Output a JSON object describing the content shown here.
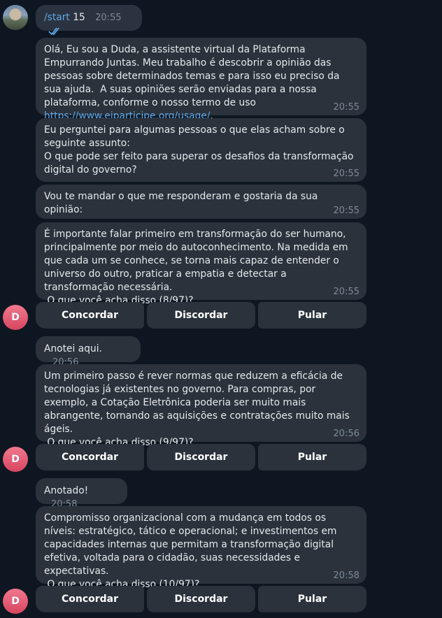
{
  "user": {
    "command_text": "/start",
    "command_arg": "15",
    "time": "20:55"
  },
  "bot_avatar_letter": "D",
  "messages": [
    {
      "text": "Olá, Eu sou a Duda, a assistente virtual da Plataforma Empurrando Juntas. Meu trabalho é descobrir a opinião das pessoas sobre determinados temas e para isso eu preciso da sua ajuda.  A suas opiniões serão enviadas para a nossa plataforma, conforme o nosso termo de uso ",
      "link": "https://www.ejparticipe.org/usage/",
      "after_link": ".",
      "time": "20:55"
    },
    {
      "text": "Eu perguntei para algumas pessoas o que elas acham sobre o seguinte assunto:\nO que pode ser feito para superar os desafios da transformação digital do governo?",
      "time": "20:55"
    },
    {
      "text": "Vou te mandar o que me responderam e gostaria da sua opinião:",
      "time": "20:55"
    },
    {
      "text": "É importante falar primeiro em transformação do ser humano, principalmente por meio do autoconhecimento. Na medida em que cada um se conhece, se torna mais capaz de entender o universo do outro, praticar a empatia e detectar a transformação necessária.\n O que você acha disso (8/97)?",
      "time": "20:55"
    },
    {
      "text": "Anotei aqui.",
      "time": "20:56"
    },
    {
      "text": "Um primeiro passo é rever normas que reduzem a eficácia de tecnologias já existentes no governo. Para compras, por exemplo, a Cotação Eletrônica poderia ser muito mais abrangente, tornando as aquisições e contratações muito mais ágeis.\n O que você acha disso (9/97)?",
      "time": "20:56"
    },
    {
      "text": "Anotado!",
      "time": "20:58"
    },
    {
      "text": "Compromisso organizacional com a mudança em todos os níveis: estratégico, tático e operacional; e investimentos em capacidades internas que permitam a transformação digital efetiva, voltada para o cidadão, suas necessidades e expectativas.\n O que você acha disso (10/97)?",
      "time": "20:58"
    }
  ],
  "keyboard": {
    "agree": "Concordar",
    "disagree": "Discordar",
    "skip": "Pular"
  }
}
